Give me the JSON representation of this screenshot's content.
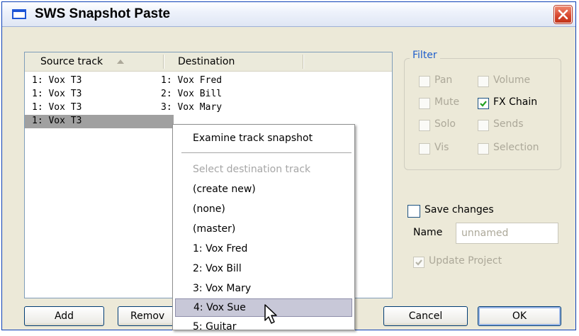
{
  "window": {
    "title": "SWS Snapshot Paste",
    "close_icon": "close-icon"
  },
  "list": {
    "columns": [
      "Source track",
      "Destination"
    ],
    "sort_icon": "sort-ascending-icon",
    "rows": [
      {
        "source": "1: Vox T3",
        "destination": "1: Vox Fred"
      },
      {
        "source": "1: Vox T3",
        "destination": "2: Vox Bill"
      },
      {
        "source": "1: Vox T3",
        "destination": "3: Vox Mary"
      },
      {
        "source": "1: Vox T3",
        "destination": "",
        "selected": true
      }
    ]
  },
  "filter": {
    "title": "Filter",
    "options": [
      {
        "label": "Pan",
        "checked": false,
        "enabled": false
      },
      {
        "label": "Volume",
        "checked": false,
        "enabled": false
      },
      {
        "label": "Mute",
        "checked": false,
        "enabled": false
      },
      {
        "label": "FX Chain",
        "checked": true,
        "enabled": true
      },
      {
        "label": "Solo",
        "checked": false,
        "enabled": false
      },
      {
        "label": "Sends",
        "checked": false,
        "enabled": false
      },
      {
        "label": "Vis",
        "checked": false,
        "enabled": false
      },
      {
        "label": "Selection",
        "checked": false,
        "enabled": false
      }
    ]
  },
  "save": {
    "save_changes_label": "Save changes",
    "save_changes_checked": false,
    "name_label": "Name",
    "name_placeholder": "unnamed",
    "update_project_label": "Update Project",
    "update_project_checked": true
  },
  "buttons": {
    "add": "Add",
    "remove": "Remov",
    "cancel": "Cancel",
    "ok": "OK"
  },
  "context_menu": {
    "items": [
      {
        "label": "Examine track snapshot",
        "disabled": false
      },
      {
        "label": "Select destination track",
        "disabled": true
      },
      {
        "label": "(create new)",
        "disabled": false
      },
      {
        "label": "(none)",
        "disabled": false
      },
      {
        "label": "(master)",
        "disabled": false
      },
      {
        "label": "1: Vox Fred",
        "disabled": false
      },
      {
        "label": "2: Vox Bill",
        "disabled": false
      },
      {
        "label": "3: Vox Mary",
        "disabled": false
      },
      {
        "label": "4: Vox Sue",
        "disabled": false,
        "hovered": true
      },
      {
        "label": "5: Guitar",
        "disabled": false
      }
    ]
  },
  "colors": {
    "title_text": "#000000",
    "group_label": "#1f5ecb",
    "selection": "#a0a0a0",
    "menu_hover": "#c8c8d8"
  }
}
